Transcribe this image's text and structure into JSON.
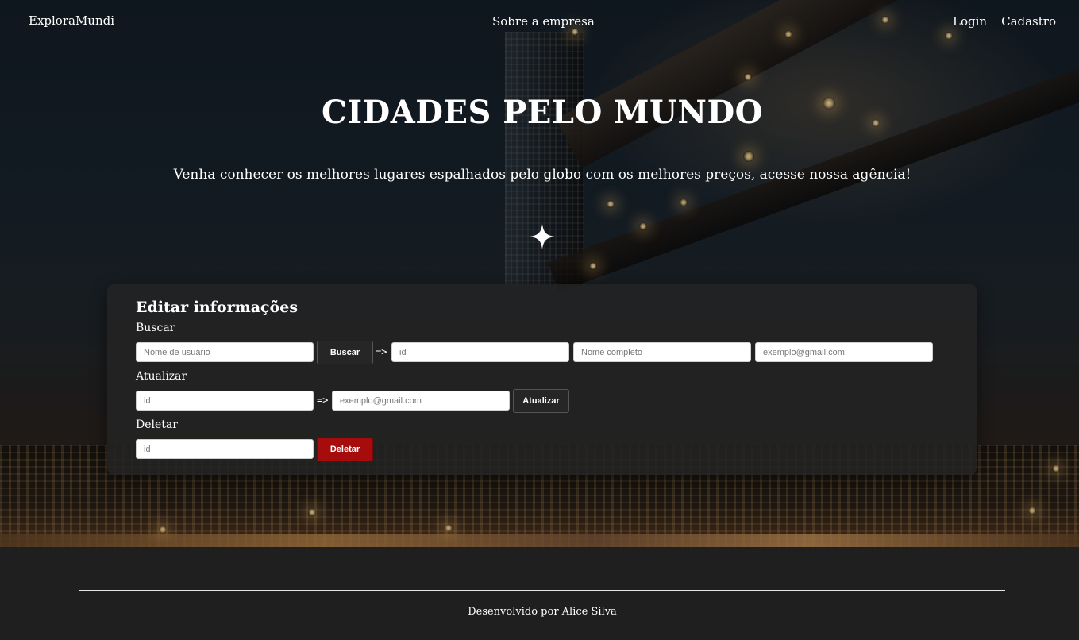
{
  "navbar": {
    "brand": "ExploraMundi",
    "center_link": "Sobre a empresa",
    "login": "Login",
    "signup": "Cadastro"
  },
  "hero": {
    "title": "CIDADES PELO MUNDO",
    "subtitle": "Venha conhecer os melhores lugares espalhados pelo globo com os melhores preços, acesse nossa agência!",
    "icon": "sparkle-icon"
  },
  "edit_card": {
    "title": "Editar informações",
    "search": {
      "label": "Buscar",
      "username_placeholder": "Nome de usuário",
      "button": "Buscar",
      "arrow": "=>",
      "id_placeholder": "id",
      "fullname_placeholder": "Nome completo",
      "email_placeholder": "exemplo@gmail.com"
    },
    "update": {
      "label": "Atualizar",
      "id_placeholder": "id",
      "arrow": "=>",
      "email_placeholder": "exemplo@gmail.com",
      "button": "Atualizar"
    },
    "delete": {
      "label": "Deletar",
      "id_placeholder": "id",
      "button": "Deletar"
    }
  },
  "footer": {
    "credit": "Desenvolvido por Alice Silva"
  },
  "colors": {
    "page_bg": "#1f1f1f",
    "card_bg": "#232323",
    "button_bg": "#262626",
    "danger": "#a70c0c",
    "text": "#ffffff"
  }
}
